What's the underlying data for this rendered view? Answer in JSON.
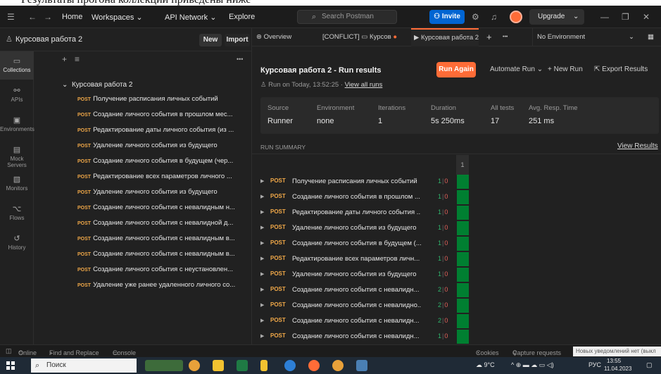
{
  "doc_caption": "Результаты прогона коллекции приведены ниже",
  "header": {
    "home": "Home",
    "workspaces": "Workspaces",
    "api_network": "API Network",
    "explore": "Explore",
    "search_placeholder": "Search Postman",
    "invite": "Invite",
    "upgrade": "Upgrade"
  },
  "workspace": {
    "name": "Курсовая работа 2",
    "new_label": "New",
    "import_label": "Import"
  },
  "rail": {
    "items": [
      "Collections",
      "APIs",
      "Environments",
      "Mock Servers",
      "Monitors",
      "Flows",
      "History"
    ]
  },
  "tree": {
    "collection": "Курсовая работа 2",
    "method": "POST",
    "requests": [
      "Получение расписания личных событий",
      "Создание личного события в прошлом мес...",
      "Редактирование даты личного события (из ...",
      "Удаление личного события из будущего",
      "Создание личного события в будущем (чер...",
      "Редактирование всех параметров личного ...",
      "Удаление личного события из будущего",
      "Создание личного события с невалидным н...",
      "Создание личного события с невалидной д...",
      "Создание личного события с невалидным в...",
      "Создание личного события с невалидным в...",
      "Создание личного события с неустановлен...",
      "Удаление уже ранее удаленного личного со..."
    ]
  },
  "tabs": {
    "overview": "Overview",
    "conflict": "[CONFLICT]",
    "conflict_name": "Курсов",
    "active": "Курсовая работа 2",
    "environment": "No Environment"
  },
  "run": {
    "title": "Курсовая работа 2 - Run results",
    "subtitle": "Run on Today, 13:52:25",
    "view_all": "View all runs",
    "run_again": "Run Again",
    "automate": "Automate Run",
    "new_run": "New Run",
    "export": "Export Results"
  },
  "stats": [
    {
      "label": "Source",
      "value": "Runner"
    },
    {
      "label": "Environment",
      "value": "none"
    },
    {
      "label": "Iterations",
      "value": "1"
    },
    {
      "label": "Duration",
      "value": "5s 250ms"
    },
    {
      "label": "All tests",
      "value": "17"
    },
    {
      "label": "Avg. Resp. Time",
      "value": "251 ms"
    }
  ],
  "summary": {
    "heading": "RUN SUMMARY",
    "view_results": "View Results",
    "iteration_label": "1",
    "method": "POST",
    "rows": [
      {
        "name": "Получение расписания личных событий",
        "passed": "1",
        "failed": "0"
      },
      {
        "name": "Создание личного события в прошлом ...",
        "passed": "1",
        "failed": "0"
      },
      {
        "name": "Редактирование даты личного события ...",
        "passed": "1",
        "failed": "0"
      },
      {
        "name": "Удаление личного события из будущего",
        "passed": "1",
        "failed": "0"
      },
      {
        "name": "Создание личного события в будущем (...",
        "passed": "1",
        "failed": "0"
      },
      {
        "name": "Редактирование всех параметров личн...",
        "passed": "1",
        "failed": "0"
      },
      {
        "name": "Удаление личного события из будущего",
        "passed": "1",
        "failed": "0"
      },
      {
        "name": "Создание личного события с невалидн...",
        "passed": "2",
        "failed": "0"
      },
      {
        "name": "Создание личного события с невалидно...",
        "passed": "2",
        "failed": "0"
      },
      {
        "name": "Создание личного события с невалидн...",
        "passed": "2",
        "failed": "0"
      },
      {
        "name": "Создание личного события с невалидн...",
        "passed": "1",
        "failed": "0"
      }
    ]
  },
  "statusbar": {
    "online": "Online",
    "find_replace": "Find and Replace",
    "console": "Console",
    "cookies": "Cookies",
    "capture": "Capture requests",
    "notification": "Новых уведомлений нет (выкл"
  },
  "taskbar": {
    "search": "Поиск",
    "weather": "9°C",
    "lang": "РУС",
    "time": "13:55",
    "date": "11.04.2023"
  },
  "colors": {
    "accent": "#ff6c37",
    "invite_blue": "#0265d2",
    "pass_green": "#2fb36b",
    "iteration_bar": "#007f31",
    "method_post": "#f0a848"
  }
}
